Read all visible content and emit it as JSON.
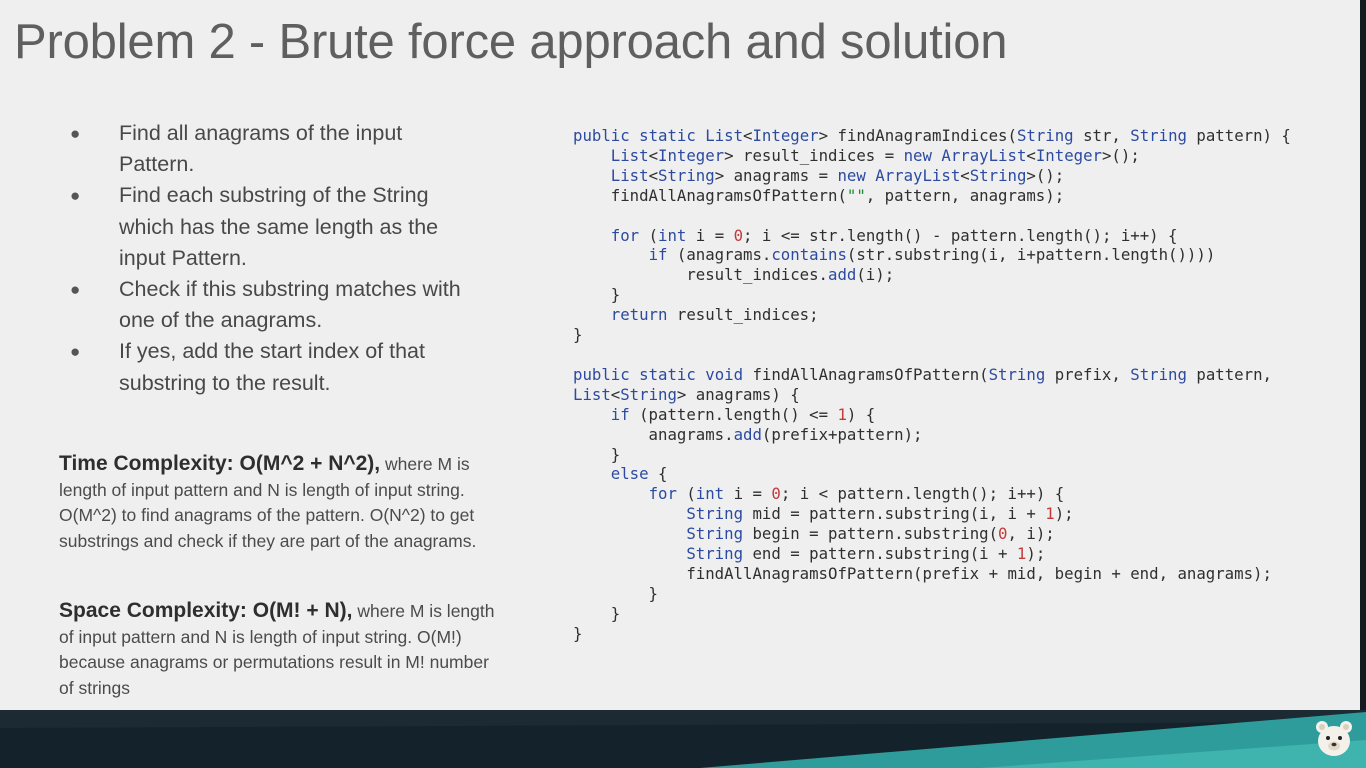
{
  "title": "Problem 2 - Brute force approach and solution",
  "bullets": [
    "Find all anagrams of the input Pattern.",
    "Find each substring of the String which has the same length as the input Pattern.",
    "Check if this substring matches with one of the anagrams.",
    "If yes, add the start index of that substring to the result."
  ],
  "time_complexity": {
    "heading": "Time Complexity",
    "separator": ": ",
    "value": "O(M^2 + N^2),",
    "text": " where M is length of input pattern and N is length of input string. O(M^2) to find anagrams of the pattern. O(N^2) to get substrings and check if they are part of the anagrams."
  },
  "space_complexity": {
    "heading": "Space Complexity",
    "separator": ": ",
    "value": "O(M! + N),",
    "text": " where M is length of input pattern and N is length of input string. O(M!) because anagrams or permutations result in M! number of strings"
  },
  "code_lines": [
    "public static List<Integer> findAnagramIndices(String str, String pattern) {",
    "    List<Integer> result_indices = new ArrayList<Integer>();",
    "    List<String> anagrams = new ArrayList<String>();",
    "    findAllAnagramsOfPattern(\"\", pattern, anagrams);",
    "",
    "    for (int i = 0; i <= str.length() - pattern.length(); i++) {",
    "        if (anagrams.contains(str.substring(i, i+pattern.length())))",
    "            result_indices.add(i);",
    "    }",
    "    return result_indices;",
    "}",
    "",
    "public static void findAllAnagramsOfPattern(String prefix, String pattern,",
    "List<String> anagrams) {",
    "    if (pattern.length() <= 1) {",
    "        anagrams.add(prefix+pattern);",
    "    }",
    "    else {",
    "        for (int i = 0; i < pattern.length(); i++) {",
    "            String mid = pattern.substring(i, i + 1);",
    "            String begin = pattern.substring(0, i);",
    "            String end = pattern.substring(i + 1);",
    "            findAllAnagramsOfPattern(prefix + mid, begin + end, anagrams);",
    "        }",
    "    }",
    "}"
  ],
  "colors": {
    "title": "#5f5f5f",
    "keyword": "#2b4aa0",
    "number": "#c23a3a",
    "string": "#1d8a33",
    "footer_dark": "#1b2a33",
    "footer_teal": "#2e9c9a"
  },
  "icons": {
    "logo": "bear-face-icon",
    "bullet": "bullet-dot-icon"
  }
}
